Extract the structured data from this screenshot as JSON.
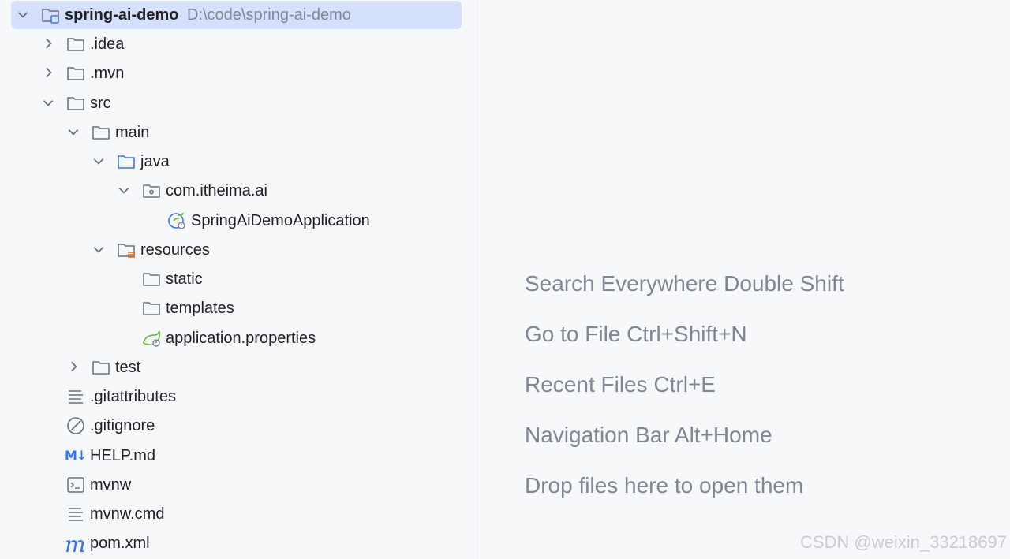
{
  "project": {
    "name": "spring-ai-demo",
    "path": "D:\\code\\spring-ai-demo"
  },
  "tree": {
    "idea": ".idea",
    "mvn_dir": ".mvn",
    "src": "src",
    "main": "main",
    "java": "java",
    "package": "com.itheima.ai",
    "app_class": "SpringAiDemoApplication",
    "resources": "resources",
    "static": "static",
    "templates": "templates",
    "app_props": "application.properties",
    "test": "test",
    "gitattributes": ".gitattributes",
    "gitignore": ".gitignore",
    "help_md": "HELP.md",
    "mvnw": "mvnw",
    "mvnw_cmd": "mvnw.cmd",
    "pom": "pom.xml",
    "md_icon_text": "M↓",
    "maven_icon_text": "m"
  },
  "editor_hints": [
    "Search Everywhere Double Shift",
    "Go to File Ctrl+Shift+N",
    "Recent Files Ctrl+E",
    "Navigation Bar Alt+Home",
    "Drop files here to open them"
  ],
  "watermark": "CSDN @weixin_33218697",
  "colors": {
    "selection": "#d5e1fc",
    "hint_text": "#818594",
    "accent_blue": "#3574f0",
    "spring_green": "#5fb832"
  }
}
